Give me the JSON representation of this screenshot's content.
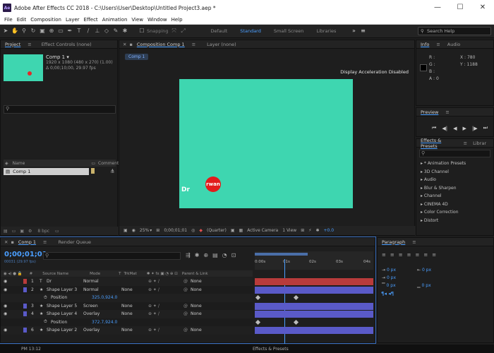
{
  "titlebar": {
    "logo": "Ae",
    "title": "Adobe After Effects CC 2018 - C:\\Users\\User\\Desktop\\Untitled Project3.aep *",
    "minimize": "—",
    "maximize": "☐",
    "close": "✕"
  },
  "menu": [
    "File",
    "Edit",
    "Composition",
    "Layer",
    "Effect",
    "Animation",
    "View",
    "Window",
    "Help"
  ],
  "toolbar": {
    "snapping": "Snapping",
    "workspaces": [
      "Default",
      "Standard",
      "Small Screen",
      "Libraries"
    ],
    "active_workspace": "Standard",
    "search_placeholder": "Search Help"
  },
  "project": {
    "tabs": [
      "Project",
      "Effect Controls (none)"
    ],
    "item_name": "Comp 1 ▾",
    "item_info": [
      "1920 x 1080  (480 x 270) (1.00)",
      "Δ 0;00;10;00, 29.97 fps"
    ],
    "col_name": "Name",
    "col_comment": "Comment",
    "row_name": "Comp 1",
    "bpc": "8 bpc"
  },
  "composition": {
    "tab": "Composition Comp 1",
    "layer_tab": "Layer (none)",
    "flow_tab": "Comp 1",
    "accel": "Display Acceleration Disabled",
    "text_dr": "Dr",
    "text_rwan": "rwan",
    "zoom": "25%",
    "timecode": "0;00;01;01",
    "quality": "(Quarter)",
    "camera": "Active Camera",
    "view": "1 View",
    "exposure": "+0.0"
  },
  "info": {
    "tabs": [
      "Info",
      "Audio"
    ],
    "channels": [
      "R :",
      "G :",
      "B :",
      "A : 0"
    ],
    "x": "X : 780",
    "y": "Y : 1188"
  },
  "preview": {
    "title": "Preview",
    "controls": [
      "⏮",
      "◀|",
      "◀",
      "▶",
      "|▶",
      "⏭"
    ]
  },
  "effects": {
    "tabs": [
      "Effects & Presets",
      "Librar"
    ],
    "items": [
      "* Animation Presets",
      "3D Channel",
      "Audio",
      "Blur & Sharpen",
      "Channel",
      "CINEMA 4D",
      "Color Correction",
      "Distort"
    ]
  },
  "timeline": {
    "tabs": [
      "Comp 1",
      "Render Queue"
    ],
    "timecode": "0;00;01;01",
    "frames": "00031 (29.97 fps)",
    "columns": [
      "#",
      "Source Name",
      "Mode",
      "T",
      "TrkMat",
      "Parent & Link"
    ],
    "ruler": [
      "0:00s",
      "01s",
      "02s",
      "03s",
      "04s"
    ],
    "rows": [
      {
        "num": "1",
        "name": "Dr",
        "mode": "Normal",
        "trk": "",
        "parent": "None",
        "color": "#b83b3b",
        "type": "T"
      },
      {
        "num": "2",
        "name": "Shape Layer 3",
        "mode": "Normal",
        "trk": "None",
        "parent": "None",
        "color": "#5a5ac8",
        "type": "★"
      },
      {
        "num": "",
        "name": "Position",
        "mode": "325.0,924.0",
        "trk": "",
        "parent": "",
        "color": "",
        "type": "prop"
      },
      {
        "num": "3",
        "name": "Shape Layer 5",
        "mode": "Screen",
        "trk": "None",
        "parent": "None",
        "color": "#5a5ac8",
        "type": "★"
      },
      {
        "num": "4",
        "name": "Shape Layer 4",
        "mode": "Overlay",
        "trk": "None",
        "parent": "None",
        "color": "#5a5ac8",
        "type": "★"
      },
      {
        "num": "",
        "name": "Position",
        "mode": "372.7,924.0",
        "trk": "",
        "parent": "",
        "color": "",
        "type": "prop"
      },
      {
        "num": "6",
        "name": "Shape Layer 2",
        "mode": "Overlay",
        "trk": "None",
        "parent": "None",
        "color": "#5a5ac8",
        "type": "★"
      }
    ]
  },
  "paragraph": {
    "title": "Paragraph",
    "values": [
      "0 px",
      "0 px",
      "0 px",
      "0 px",
      "0 px"
    ]
  },
  "status": {
    "left": "PM 13:12",
    "right": "Effects & Presets"
  }
}
